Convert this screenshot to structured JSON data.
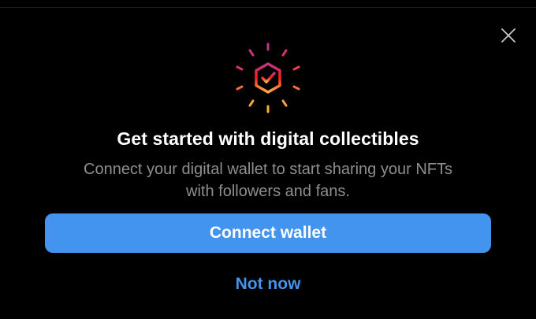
{
  "dialog": {
    "title": "Get started with digital collectibles",
    "subtitle_line1": "Connect your digital wallet to start sharing your NFTs",
    "subtitle_line2": "with followers and fans.",
    "primary_button_label": "Connect wallet",
    "secondary_button_label": "Not now"
  },
  "icons": {
    "close": "close-icon",
    "logo": "collectibles-badge-icon"
  },
  "colors": {
    "background": "#000000",
    "accent": "#4294ee",
    "subtitle": "#8e8e8e",
    "gradient_top": "#c13584",
    "gradient_mid": "#fd1d1d",
    "gradient_bottom": "#fcaf45"
  }
}
